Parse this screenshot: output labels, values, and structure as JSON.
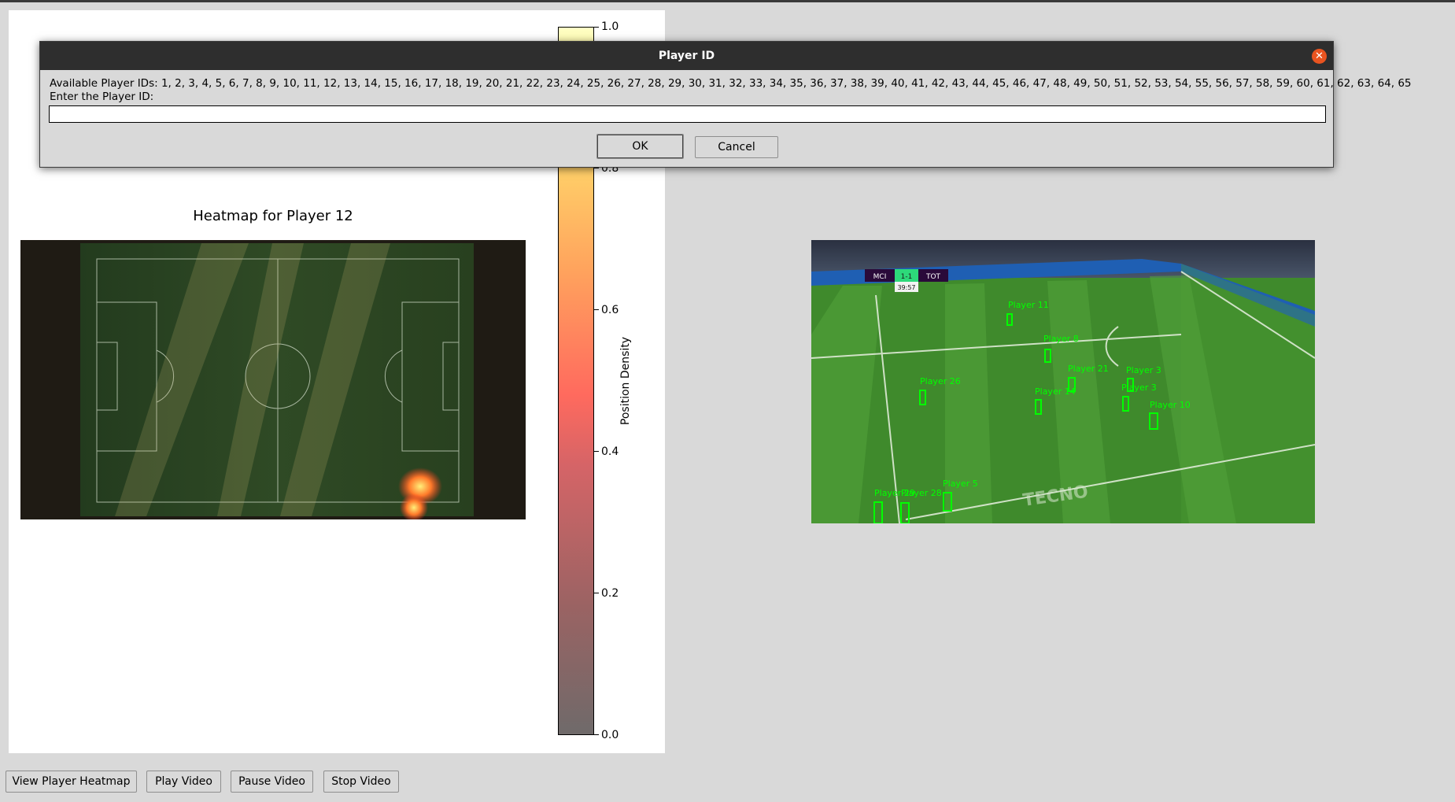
{
  "dialog": {
    "title": "Player ID",
    "available_label": "Available Player IDs: 1, 2, 3, 4, 5, 6, 7, 8, 9, 10, 11, 12, 13, 14, 15, 16, 17, 18, 19, 20, 21, 22, 23, 24, 25, 26, 27, 28, 29, 30, 31, 32, 33, 34, 35, 36, 37, 38, 39, 40, 41, 42, 43, 44, 45, 46, 47, 48, 49, 50, 51, 52, 53, 54, 55, 56, 57, 58, 59, 60, 61, 62, 63, 64, 65",
    "prompt": "Enter the Player ID:",
    "input_value": "",
    "ok_label": "OK",
    "cancel_label": "Cancel",
    "close_icon": "close-icon"
  },
  "plot": {
    "title": "Heatmap for Player 12",
    "colorbar_label": "Position Density",
    "colorbar_ticks": [
      "0.0",
      "0.2",
      "0.4",
      "0.6",
      "0.8",
      "1.0"
    ]
  },
  "video": {
    "scoreboard": {
      "home": "MCI",
      "score": "1-1",
      "away": "TOT",
      "clock": "39:57"
    },
    "player_labels": [
      "Player 11",
      "Player 8",
      "Player 26",
      "Player 21",
      "Player 3",
      "Player 14",
      "Player 3",
      "Player 10",
      "Player 5",
      "Player 29",
      "Player 28"
    ],
    "ad_text": "TECNO"
  },
  "controls": {
    "view_heatmap_label": "View Player Heatmap",
    "play_label": "Play Video",
    "pause_label": "Pause Video",
    "stop_label": "Stop Video"
  },
  "colors": {
    "dialog_titlebar": "#2e2e2e",
    "close_button": "#e95420",
    "detection_box": "#00ff00"
  }
}
